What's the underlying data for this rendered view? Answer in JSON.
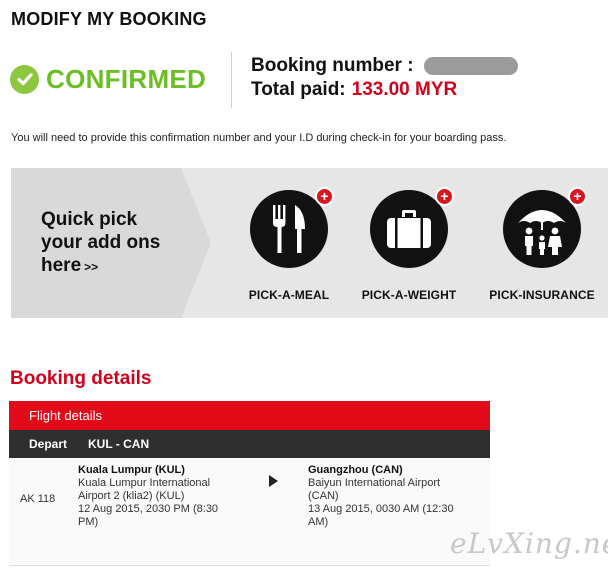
{
  "page": {
    "title": "MODIFY MY BOOKING"
  },
  "status": {
    "label": "CONFIRMED",
    "icon": "check-circle-icon",
    "color": "#6bbf22"
  },
  "booking": {
    "number_label": "Booking number :",
    "total_label": "Total paid:",
    "total_value": "133.00 MYR",
    "total_color": "#d0021b"
  },
  "note": "You will need to provide this confirmation number and your I.D during check-in for your boarding pass.",
  "addons": {
    "title_line1": "Quick pick",
    "title_line2": "your add ons",
    "title_line3": "here",
    "chevron": ">>",
    "items": [
      {
        "label": "PICK-A-MEAL",
        "icon": "meal-icon",
        "badge": "+"
      },
      {
        "label": "PICK-A-WEIGHT",
        "icon": "baggage-icon",
        "badge": "+"
      },
      {
        "label": "PICK-INSURANCE",
        "icon": "insurance-icon",
        "badge": "+"
      }
    ]
  },
  "booking_details": {
    "title": "Booking details",
    "flight_header": "Flight details",
    "direction": "Depart",
    "route": "KUL - CAN",
    "flight": {
      "number": "AK 118",
      "from": {
        "city": "Kuala Lumpur (KUL)",
        "airport_line1": "Kuala Lumpur International",
        "airport_line2": "Airport 2 (klia2) (KUL)",
        "time_line1": "12 Aug 2015, 2030 PM (8:30",
        "time_line2": "PM)"
      },
      "to": {
        "city": "Guangzhou (CAN)",
        "airport_line1": "Baiyun International Airport",
        "airport_line2": "(CAN)",
        "time_line1": "13 Aug 2015, 0030 AM (12:30",
        "time_line2": "AM)"
      }
    }
  },
  "watermark": "eLvXing.net"
}
